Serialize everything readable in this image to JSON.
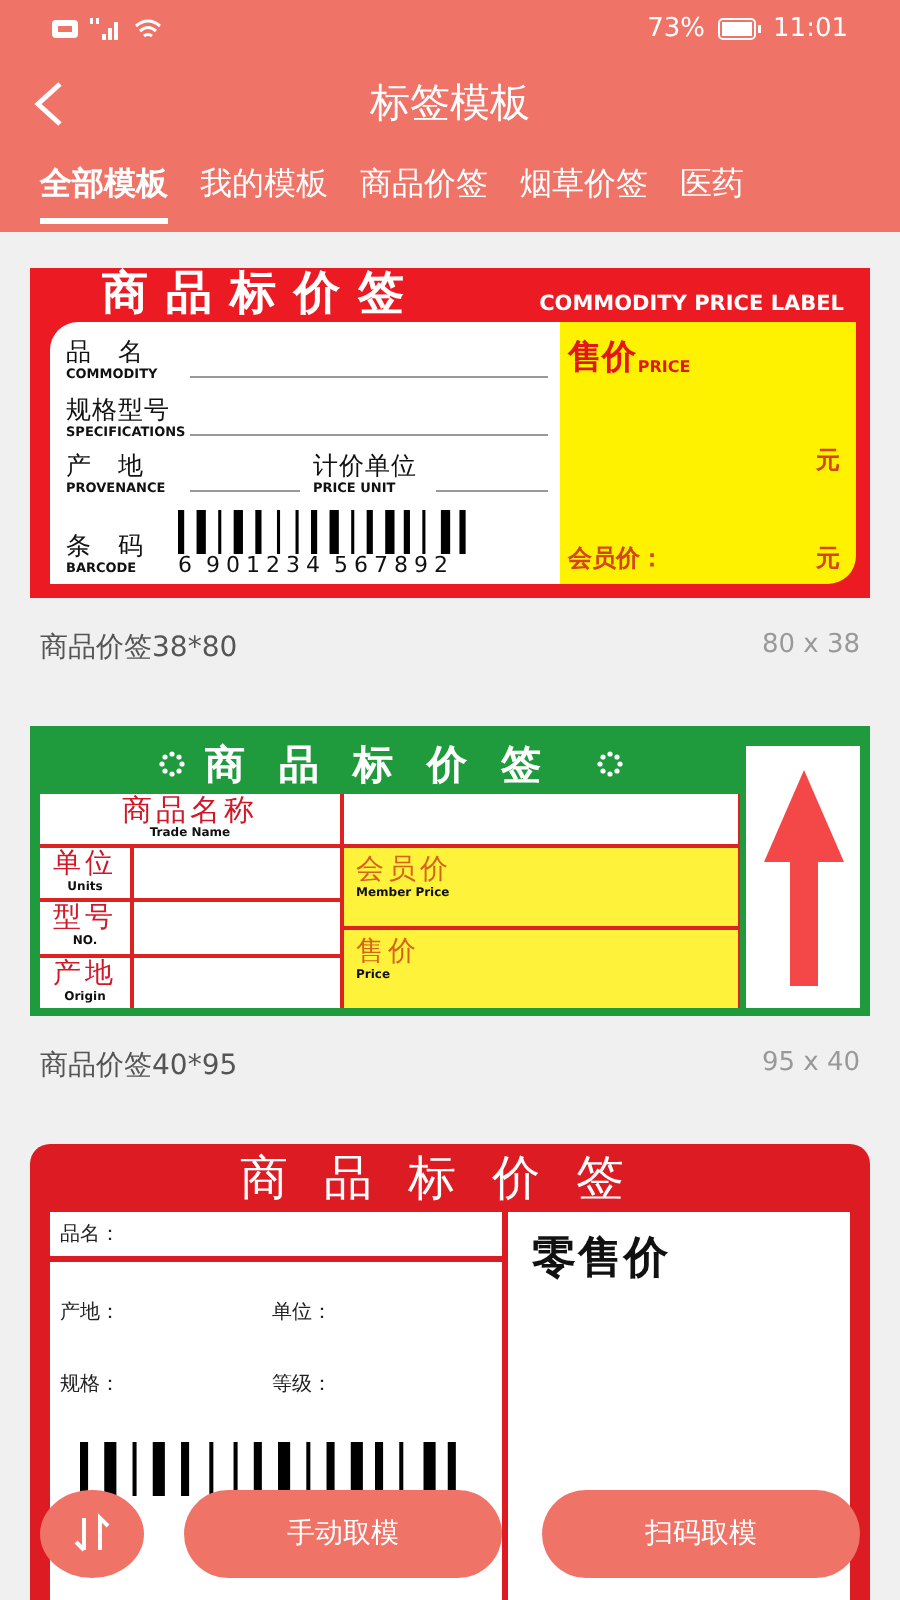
{
  "status_bar": {
    "battery": "73%",
    "time": "11:01"
  },
  "header": {
    "title": "标签模板"
  },
  "tabs": [
    {
      "label": "全部模板",
      "selected": true
    },
    {
      "label": "我的模板",
      "selected": false
    },
    {
      "label": "商品价签",
      "selected": false
    },
    {
      "label": "烟草价签",
      "selected": false
    },
    {
      "label": "医药",
      "selected": false
    }
  ],
  "templates": [
    {
      "kind": "classic",
      "title": "商品标价签",
      "subtitle": "COMMODITY PRICE LABEL",
      "fields": [
        {
          "cn": "品　名",
          "en": "COMMODITY"
        },
        {
          "cn": "规格型号",
          "en": "SPECIFICATIONS"
        },
        {
          "cn": "产　地",
          "en": "PROVENANCE"
        }
      ],
      "unit": {
        "cn": "计价单位",
        "en": "PRICE UNIT"
      },
      "barcode": {
        "cn": "条　码",
        "en": "BARCODE",
        "digits": [
          "6",
          "901234",
          "567892"
        ]
      },
      "price": {
        "cn": "售价",
        "en": "PRICE",
        "currency": "元"
      },
      "member": {
        "label": "会员价：",
        "currency": "元"
      },
      "name": "商品价签38*80",
      "size": "80 x 38"
    },
    {
      "kind": "grid",
      "title": "商品标价签",
      "trade": {
        "cn": "商品名称",
        "en": "Trade Name"
      },
      "fields": [
        {
          "cn": "单位",
          "en": "Units"
        },
        {
          "cn": "型号",
          "en": "NO."
        },
        {
          "cn": "产地",
          "en": "Origin"
        }
      ],
      "prices": [
        {
          "cn": "会员价",
          "en": "Member Price"
        },
        {
          "cn": "售价",
          "en": "Price"
        }
      ],
      "name": "商品价签40*95",
      "size": "95 x 40"
    },
    {
      "kind": "simple",
      "title": "商品标价签",
      "name_field": "品名：",
      "fields": [
        [
          "产地：",
          "单位："
        ],
        [
          "规格：",
          "等级："
        ]
      ],
      "price": "零售价"
    }
  ],
  "actions": [
    {
      "label": "手动取模"
    },
    {
      "label": "扫码取模"
    }
  ]
}
